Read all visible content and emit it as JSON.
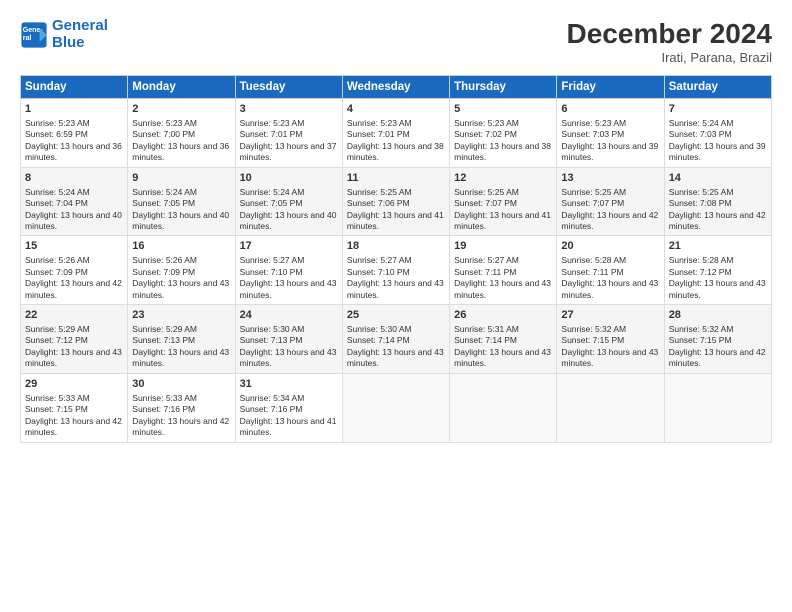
{
  "logo": {
    "line1": "General",
    "line2": "Blue"
  },
  "title": "December 2024",
  "subtitle": "Irati, Parana, Brazil",
  "days_header": [
    "Sunday",
    "Monday",
    "Tuesday",
    "Wednesday",
    "Thursday",
    "Friday",
    "Saturday"
  ],
  "weeks": [
    [
      {
        "day": "1",
        "sunrise": "Sunrise: 5:23 AM",
        "sunset": "Sunset: 6:59 PM",
        "daylight": "Daylight: 13 hours and 36 minutes."
      },
      {
        "day": "2",
        "sunrise": "Sunrise: 5:23 AM",
        "sunset": "Sunset: 7:00 PM",
        "daylight": "Daylight: 13 hours and 36 minutes."
      },
      {
        "day": "3",
        "sunrise": "Sunrise: 5:23 AM",
        "sunset": "Sunset: 7:01 PM",
        "daylight": "Daylight: 13 hours and 37 minutes."
      },
      {
        "day": "4",
        "sunrise": "Sunrise: 5:23 AM",
        "sunset": "Sunset: 7:01 PM",
        "daylight": "Daylight: 13 hours and 38 minutes."
      },
      {
        "day": "5",
        "sunrise": "Sunrise: 5:23 AM",
        "sunset": "Sunset: 7:02 PM",
        "daylight": "Daylight: 13 hours and 38 minutes."
      },
      {
        "day": "6",
        "sunrise": "Sunrise: 5:23 AM",
        "sunset": "Sunset: 7:03 PM",
        "daylight": "Daylight: 13 hours and 39 minutes."
      },
      {
        "day": "7",
        "sunrise": "Sunrise: 5:24 AM",
        "sunset": "Sunset: 7:03 PM",
        "daylight": "Daylight: 13 hours and 39 minutes."
      }
    ],
    [
      {
        "day": "8",
        "sunrise": "Sunrise: 5:24 AM",
        "sunset": "Sunset: 7:04 PM",
        "daylight": "Daylight: 13 hours and 40 minutes."
      },
      {
        "day": "9",
        "sunrise": "Sunrise: 5:24 AM",
        "sunset": "Sunset: 7:05 PM",
        "daylight": "Daylight: 13 hours and 40 minutes."
      },
      {
        "day": "10",
        "sunrise": "Sunrise: 5:24 AM",
        "sunset": "Sunset: 7:05 PM",
        "daylight": "Daylight: 13 hours and 40 minutes."
      },
      {
        "day": "11",
        "sunrise": "Sunrise: 5:25 AM",
        "sunset": "Sunset: 7:06 PM",
        "daylight": "Daylight: 13 hours and 41 minutes."
      },
      {
        "day": "12",
        "sunrise": "Sunrise: 5:25 AM",
        "sunset": "Sunset: 7:07 PM",
        "daylight": "Daylight: 13 hours and 41 minutes."
      },
      {
        "day": "13",
        "sunrise": "Sunrise: 5:25 AM",
        "sunset": "Sunset: 7:07 PM",
        "daylight": "Daylight: 13 hours and 42 minutes."
      },
      {
        "day": "14",
        "sunrise": "Sunrise: 5:25 AM",
        "sunset": "Sunset: 7:08 PM",
        "daylight": "Daylight: 13 hours and 42 minutes."
      }
    ],
    [
      {
        "day": "15",
        "sunrise": "Sunrise: 5:26 AM",
        "sunset": "Sunset: 7:09 PM",
        "daylight": "Daylight: 13 hours and 42 minutes."
      },
      {
        "day": "16",
        "sunrise": "Sunrise: 5:26 AM",
        "sunset": "Sunset: 7:09 PM",
        "daylight": "Daylight: 13 hours and 43 minutes."
      },
      {
        "day": "17",
        "sunrise": "Sunrise: 5:27 AM",
        "sunset": "Sunset: 7:10 PM",
        "daylight": "Daylight: 13 hours and 43 minutes."
      },
      {
        "day": "18",
        "sunrise": "Sunrise: 5:27 AM",
        "sunset": "Sunset: 7:10 PM",
        "daylight": "Daylight: 13 hours and 43 minutes."
      },
      {
        "day": "19",
        "sunrise": "Sunrise: 5:27 AM",
        "sunset": "Sunset: 7:11 PM",
        "daylight": "Daylight: 13 hours and 43 minutes."
      },
      {
        "day": "20",
        "sunrise": "Sunrise: 5:28 AM",
        "sunset": "Sunset: 7:11 PM",
        "daylight": "Daylight: 13 hours and 43 minutes."
      },
      {
        "day": "21",
        "sunrise": "Sunrise: 5:28 AM",
        "sunset": "Sunset: 7:12 PM",
        "daylight": "Daylight: 13 hours and 43 minutes."
      }
    ],
    [
      {
        "day": "22",
        "sunrise": "Sunrise: 5:29 AM",
        "sunset": "Sunset: 7:12 PM",
        "daylight": "Daylight: 13 hours and 43 minutes."
      },
      {
        "day": "23",
        "sunrise": "Sunrise: 5:29 AM",
        "sunset": "Sunset: 7:13 PM",
        "daylight": "Daylight: 13 hours and 43 minutes."
      },
      {
        "day": "24",
        "sunrise": "Sunrise: 5:30 AM",
        "sunset": "Sunset: 7:13 PM",
        "daylight": "Daylight: 13 hours and 43 minutes."
      },
      {
        "day": "25",
        "sunrise": "Sunrise: 5:30 AM",
        "sunset": "Sunset: 7:14 PM",
        "daylight": "Daylight: 13 hours and 43 minutes."
      },
      {
        "day": "26",
        "sunrise": "Sunrise: 5:31 AM",
        "sunset": "Sunset: 7:14 PM",
        "daylight": "Daylight: 13 hours and 43 minutes."
      },
      {
        "day": "27",
        "sunrise": "Sunrise: 5:32 AM",
        "sunset": "Sunset: 7:15 PM",
        "daylight": "Daylight: 13 hours and 43 minutes."
      },
      {
        "day": "28",
        "sunrise": "Sunrise: 5:32 AM",
        "sunset": "Sunset: 7:15 PM",
        "daylight": "Daylight: 13 hours and 42 minutes."
      }
    ],
    [
      {
        "day": "29",
        "sunrise": "Sunrise: 5:33 AM",
        "sunset": "Sunset: 7:15 PM",
        "daylight": "Daylight: 13 hours and 42 minutes."
      },
      {
        "day": "30",
        "sunrise": "Sunrise: 5:33 AM",
        "sunset": "Sunset: 7:16 PM",
        "daylight": "Daylight: 13 hours and 42 minutes."
      },
      {
        "day": "31",
        "sunrise": "Sunrise: 5:34 AM",
        "sunset": "Sunset: 7:16 PM",
        "daylight": "Daylight: 13 hours and 41 minutes."
      },
      null,
      null,
      null,
      null
    ]
  ]
}
